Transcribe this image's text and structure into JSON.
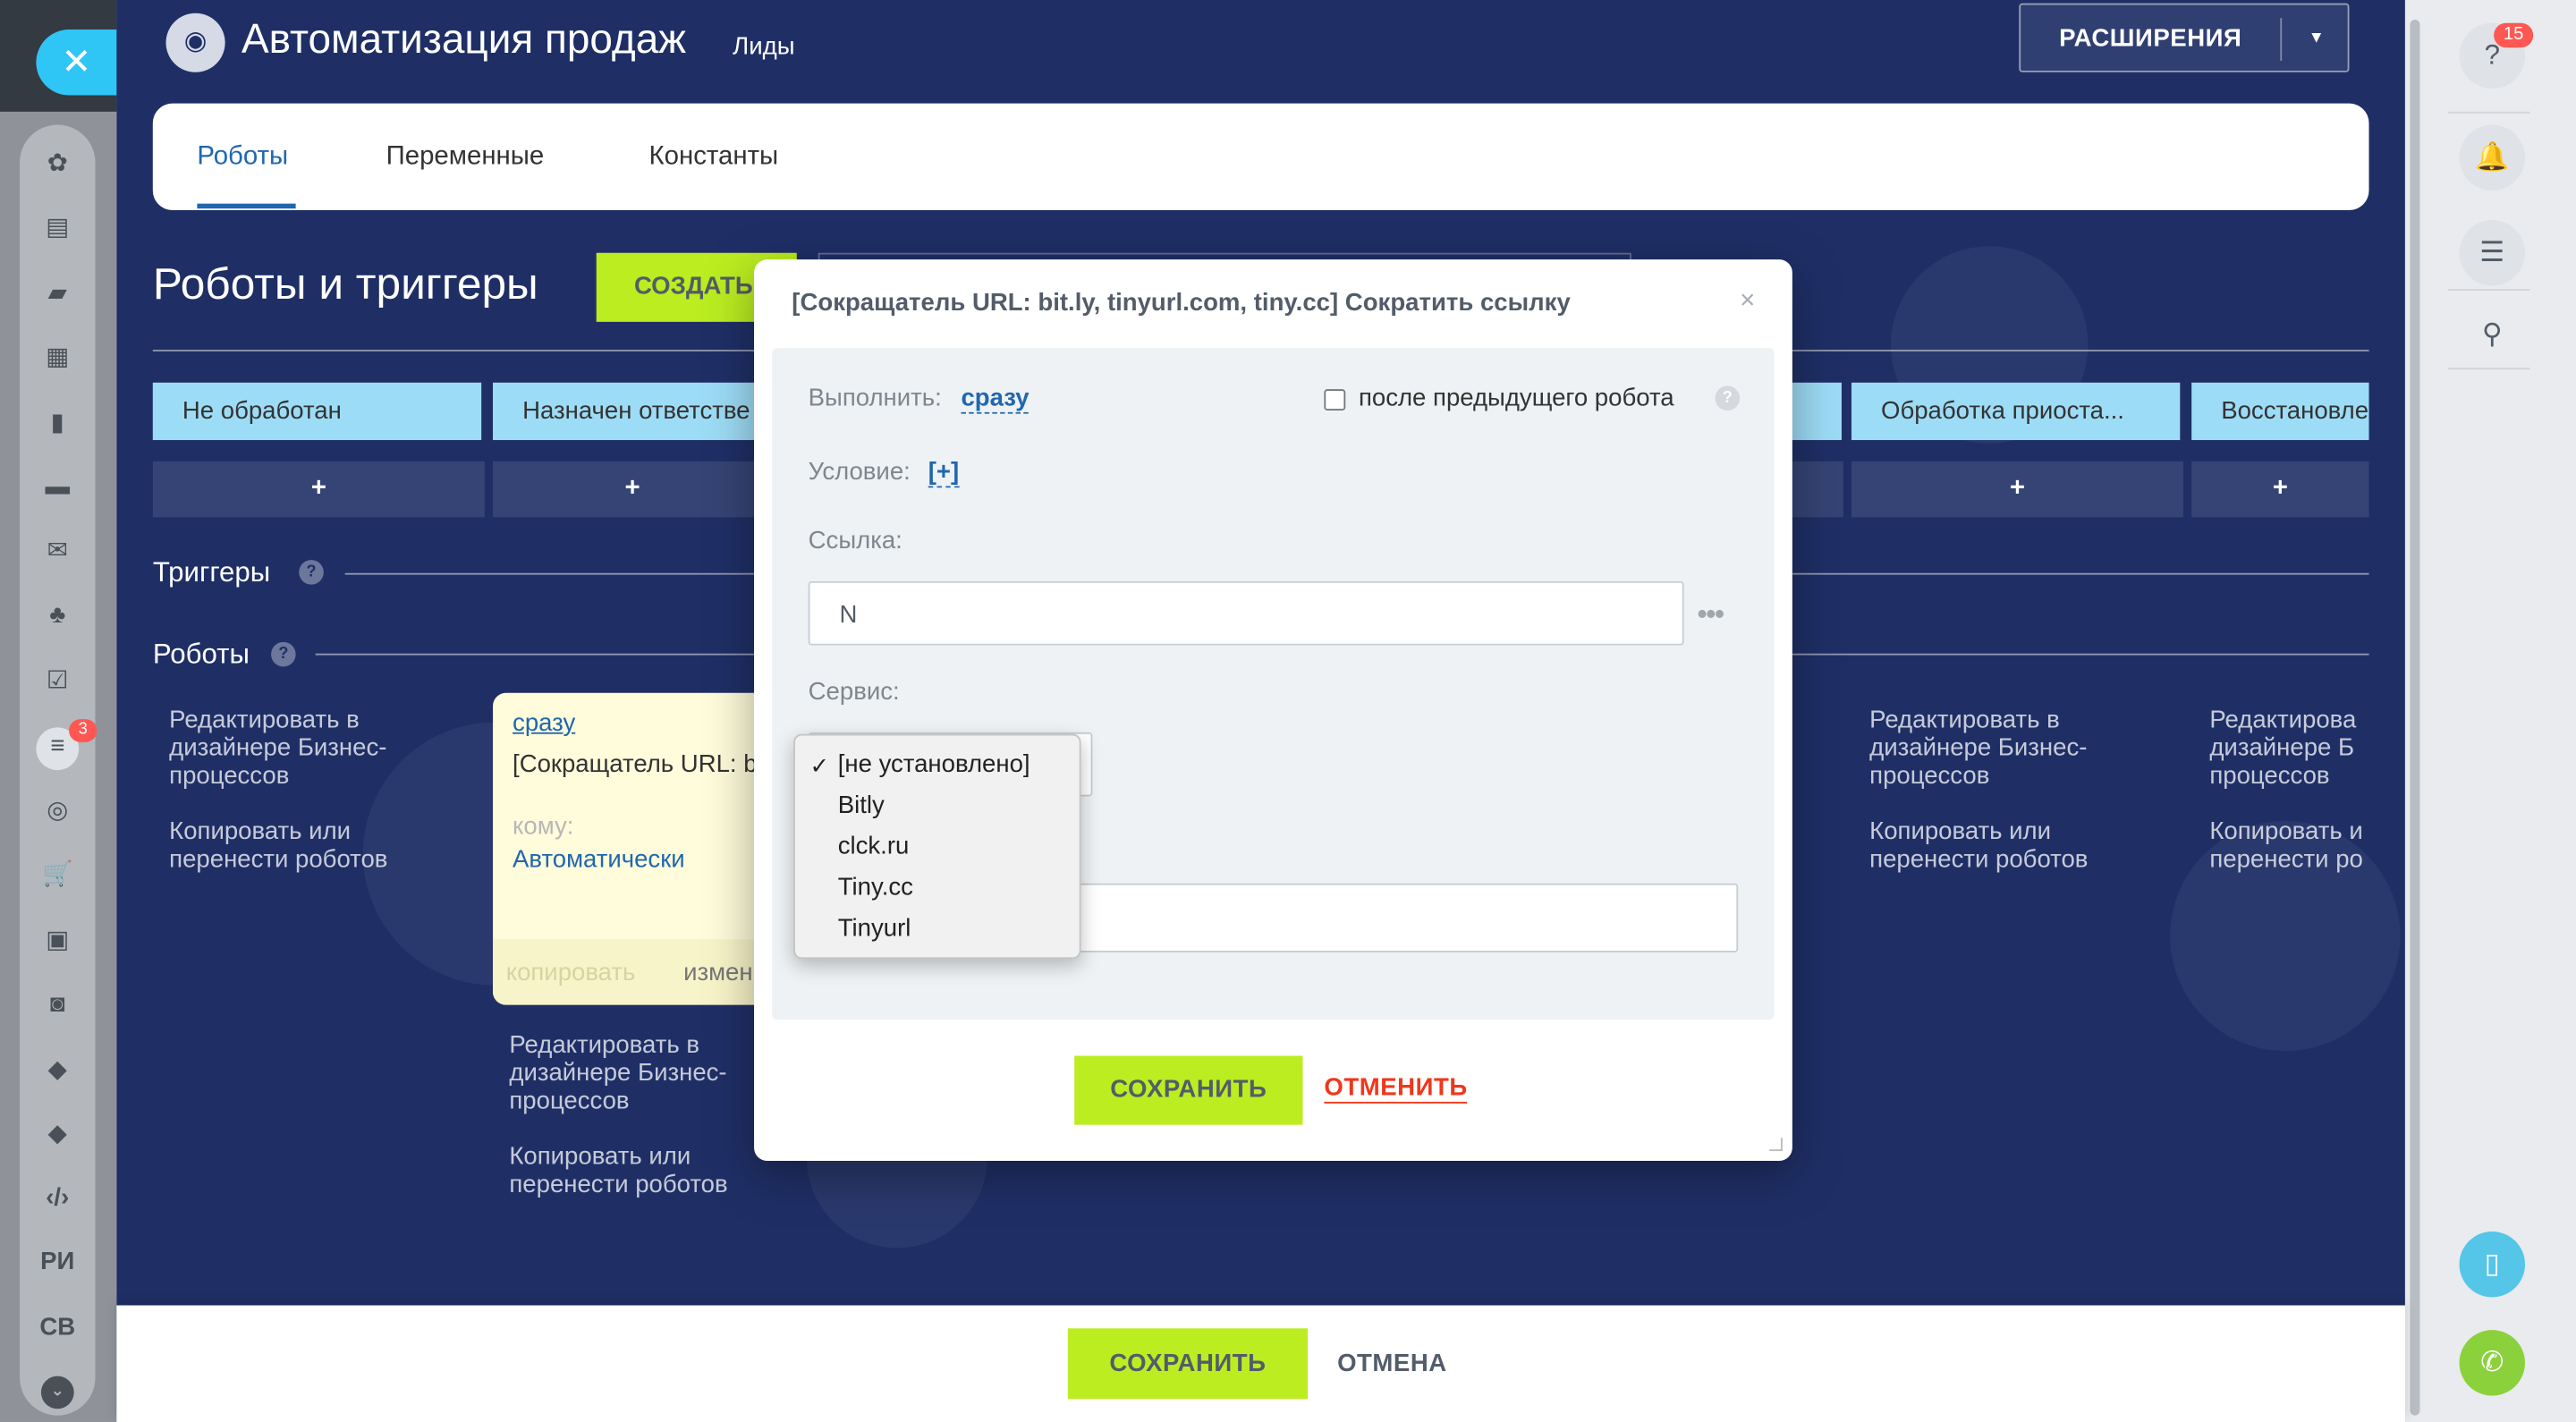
{
  "header": {
    "title": "Автоматизация продаж",
    "subtitle": "Лиды",
    "extensions_label": "РАСШИРЕНИЯ"
  },
  "tabs": [
    {
      "label": "Роботы",
      "active": true
    },
    {
      "label": "Переменные",
      "active": false
    },
    {
      "label": "Константы",
      "active": false
    }
  ],
  "page": {
    "heading": "Роботы и триггеры",
    "create_label": "СОЗДАТЬ"
  },
  "stages": [
    "Не обработан",
    "Назначен ответстве",
    "Обработка приоста...",
    "Восстановле"
  ],
  "plus_label": "+",
  "sections": {
    "triggers": "Триггеры",
    "robots": "Роботы",
    "help_glyph": "?"
  },
  "column_links": {
    "edit_designer": "Редактировать в дизайнере Бизнес-процессов",
    "copy_move": "Копировать или перенести роботов"
  },
  "robot_card": {
    "when": "сразу",
    "text": "[Сокращатель URL: bit.ly, tinyurl.com, tiny",
    "to_label": "кому:",
    "to_value": "Автоматически",
    "copy_label": "копировать",
    "edit_label": "изменить"
  },
  "dialog": {
    "title": "[Сокращатель URL: bit.ly, tinyurl.com, tiny.cc] Сократить ссылку",
    "close_glyph": "×",
    "execute_label": "Выполнить:",
    "execute_value": "сразу",
    "after_previous_label": "после предыдущего робота",
    "after_previous_checked": false,
    "condition_label": "Условие:",
    "condition_value": "[+]",
    "link_label": "Ссылка:",
    "link_value": "N",
    "service_label": "Сервис:",
    "service_selected": "[не установлено]",
    "service_options": [
      "[не установлено]",
      "Bitly",
      "clck.ru",
      "Tiny.cc",
      "Tinyurl"
    ],
    "save_label": "СОХРАНИТЬ",
    "cancel_label": "ОТМЕНИТЬ"
  },
  "leftbar": {
    "items": [
      "sites-icon",
      "tasks-icon",
      "chat-icon",
      "calendar-icon",
      "docs-icon",
      "drive-icon",
      "mail-icon",
      "groups-icon",
      "checklist-icon",
      "crm-filter-icon",
      "target-icon",
      "cart-icon",
      "contact-card-icon",
      "robot-icon",
      "box-icon",
      "box2-icon",
      "code-icon"
    ],
    "text_items": [
      "РИ",
      "СВ"
    ],
    "badge": "3"
  },
  "rightpanel": {
    "help_badge": "15"
  },
  "footer": {
    "save_label": "СОХРАНИТЬ",
    "cancel_label": "ОТМЕНА"
  },
  "colors": {
    "main_bg": "#1f2f66",
    "accent_green": "#bbed21",
    "stage_blue": "#9ddcf6",
    "link_blue": "#2067b0",
    "cancel_red": "#f0371b"
  }
}
